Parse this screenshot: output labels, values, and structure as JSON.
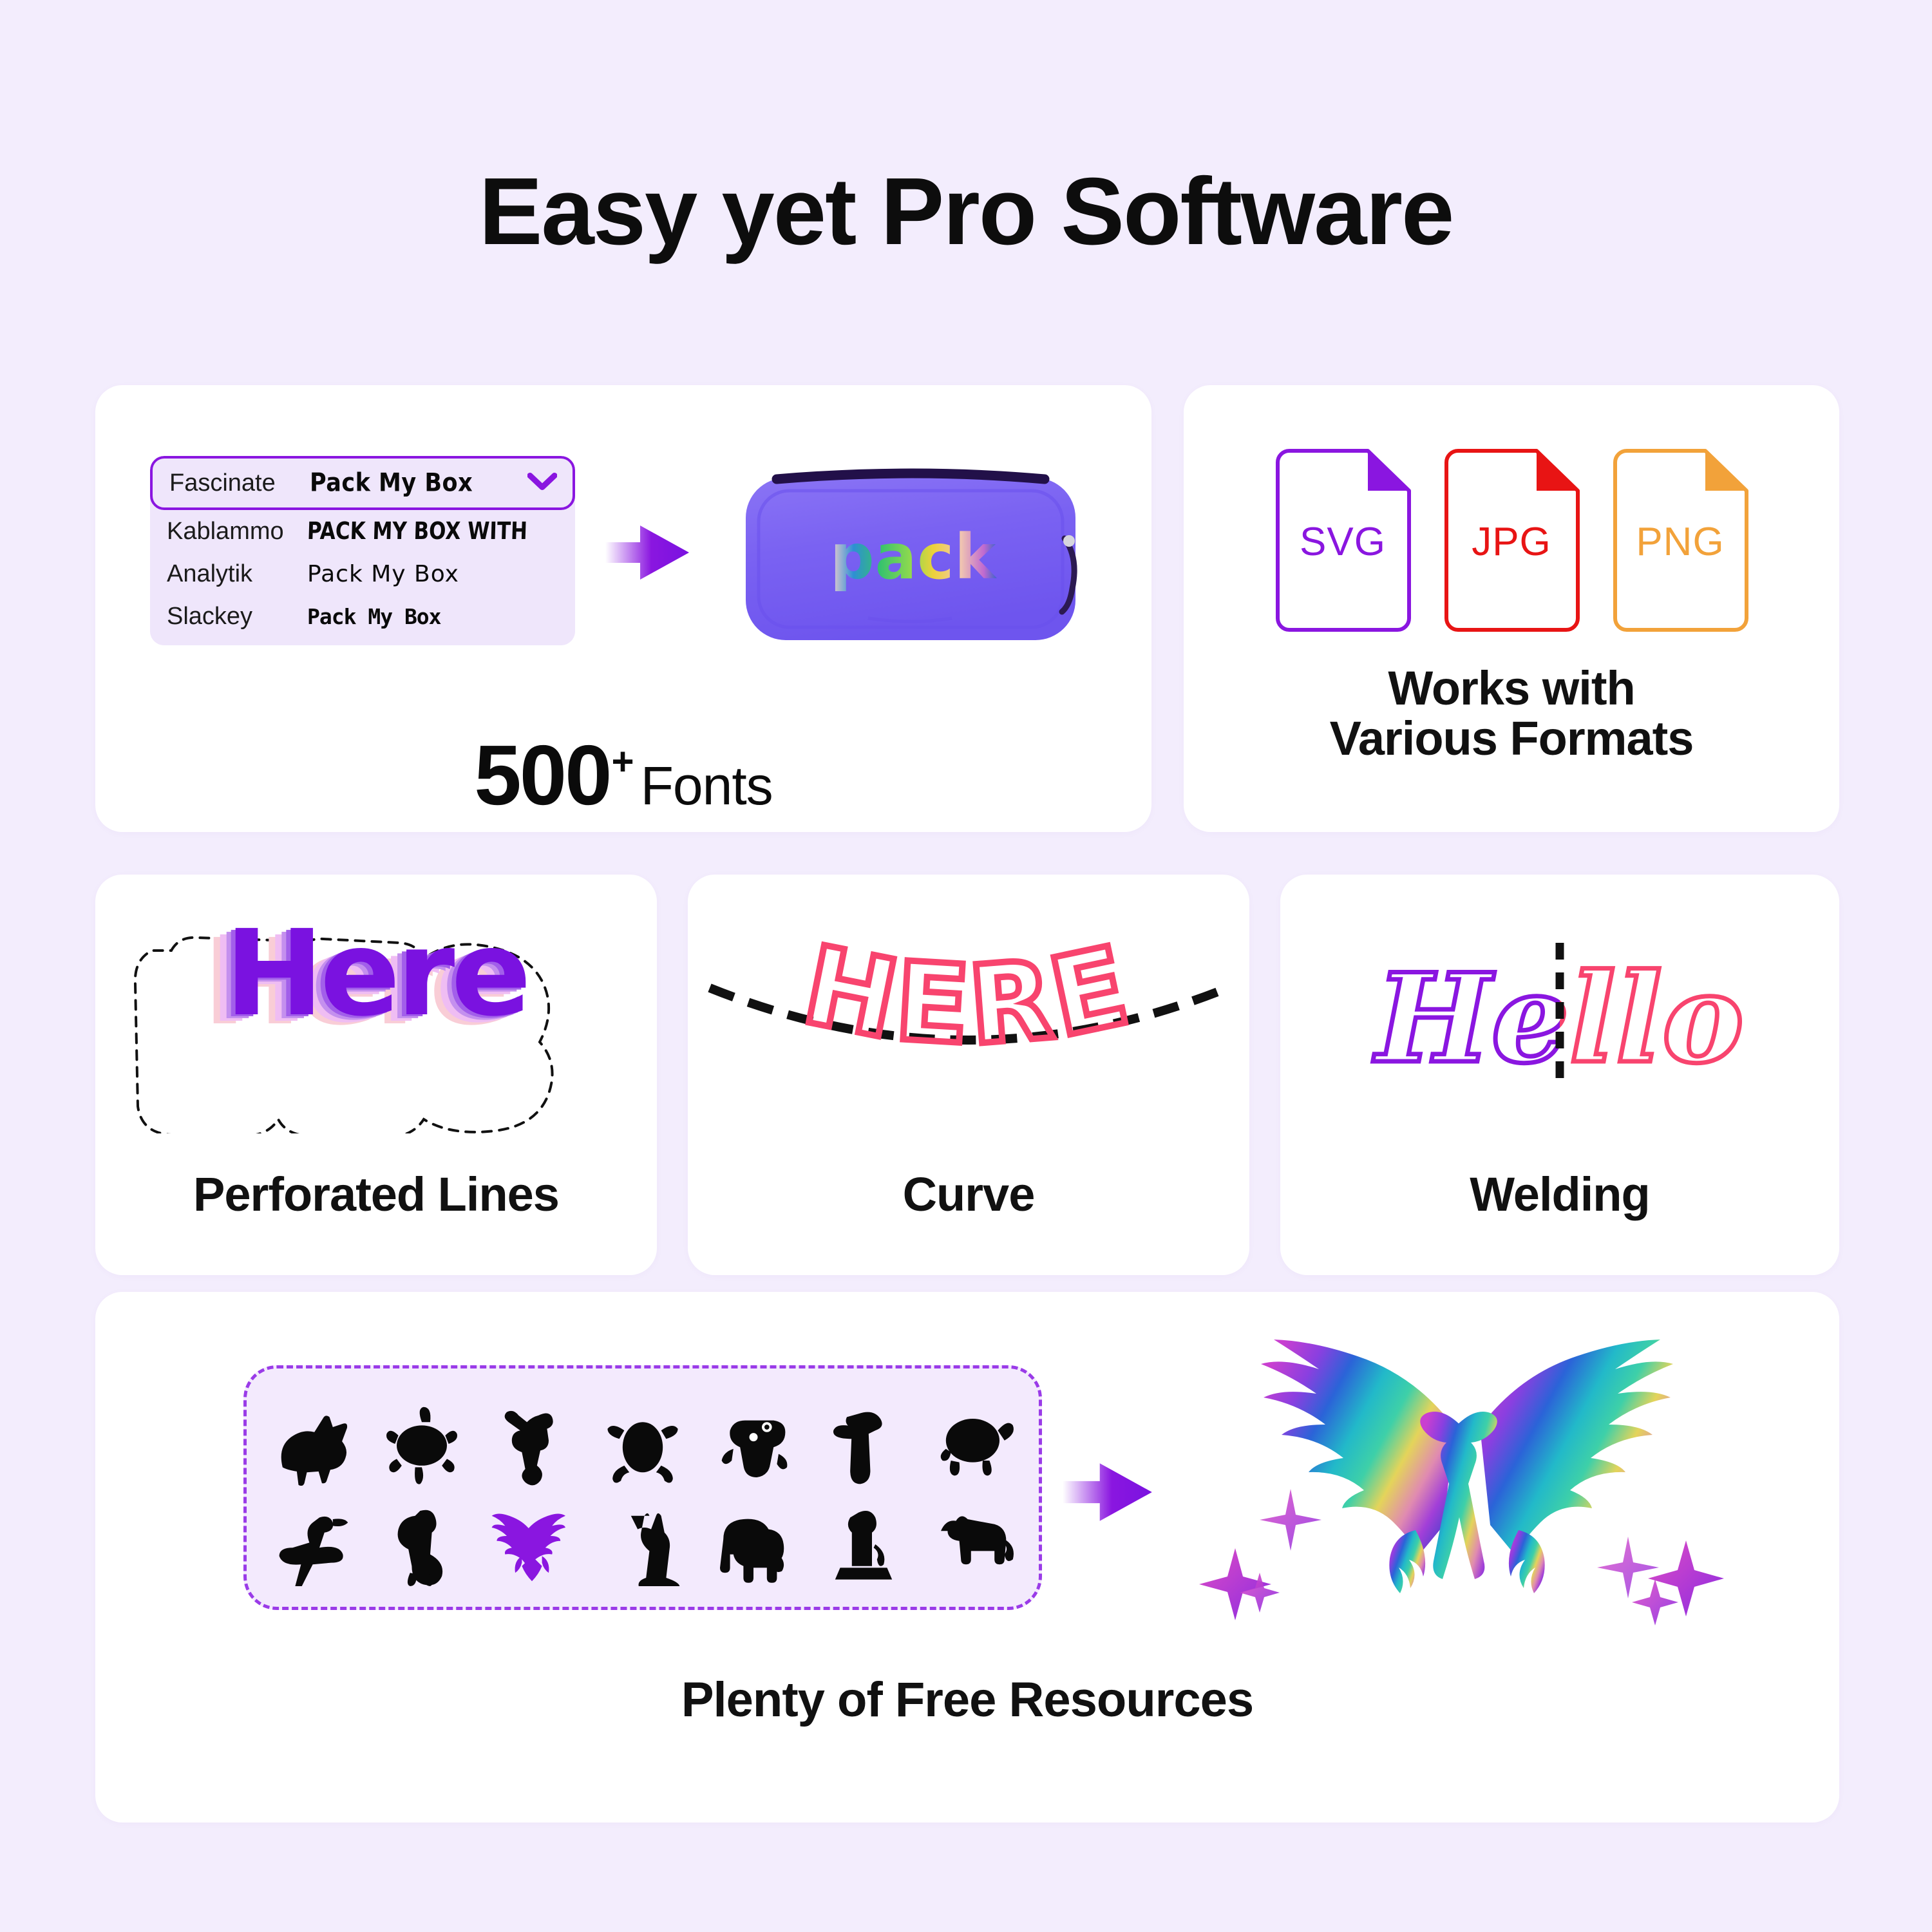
{
  "page": {
    "title": "Easy yet Pro Software",
    "background_color": "#F3EDFD",
    "card_color": "#FFFFFF",
    "accent_purple": "#8A16E0",
    "accent_pink": "#F8446E"
  },
  "fonts_card": {
    "dropdown": {
      "selected": {
        "name": "Fascinate",
        "sample": "Pack My Box"
      },
      "options": [
        {
          "name": "Kablammo",
          "sample": "PACK MY BOX WITH"
        },
        {
          "name": "Analytik",
          "sample": "Pack My Box"
        },
        {
          "name": "Slackey",
          "sample": "Pack My Box"
        }
      ],
      "chevron_icon": "chevron-down-icon"
    },
    "arrow_icon": "arrow-right-icon",
    "product": {
      "name": "pencil-case",
      "printed_text": "pack",
      "color": "#7B61F0"
    },
    "count": "500",
    "count_superscript": "+",
    "count_word": "Fonts"
  },
  "formats_card": {
    "files": [
      {
        "label": "SVG",
        "color": "#8A16E0"
      },
      {
        "label": "JPG",
        "color": "#E81414"
      },
      {
        "label": "PNG",
        "color": "#F2A23A"
      }
    ],
    "caption_line1": "Works with",
    "caption_line2": "Various Formats"
  },
  "feature_cards": [
    {
      "label": "Perforated Lines",
      "art_text": "Here",
      "art_colors": [
        "#7A12E0",
        "#B07BEF",
        "#E3B9F5",
        "#F8CFD8"
      ]
    },
    {
      "label": "Curve",
      "art_text": "HERE",
      "art_color": "#F8446E"
    },
    {
      "label": "Welding",
      "art_text": "Hello",
      "art_color_left": "#8A16E0",
      "art_color_right": "#F8446E"
    }
  ],
  "resources_card": {
    "label": "Plenty of Free Resources",
    "panel_border_color": "#9A3BE8",
    "panel_fill_color": "#F3EAFD",
    "row1_icons": [
      "pig-icon",
      "turtle-icon",
      "monkey-icon",
      "frog-icon",
      "gecko-icon",
      "toucan-icon",
      "tortoise-icon"
    ],
    "row2_icons": [
      "hummingbird-icon",
      "rooster-icon",
      "phoenix-icon",
      "cat-icon",
      "elephant-icon",
      "lion-statue-icon",
      "tiger-icon"
    ],
    "selected_icon": "phoenix-icon",
    "selected_icon_color": "#8A16E0",
    "arrow_icon": "arrow-right-icon",
    "result_graphic": "rainbow-eagle-icon"
  }
}
